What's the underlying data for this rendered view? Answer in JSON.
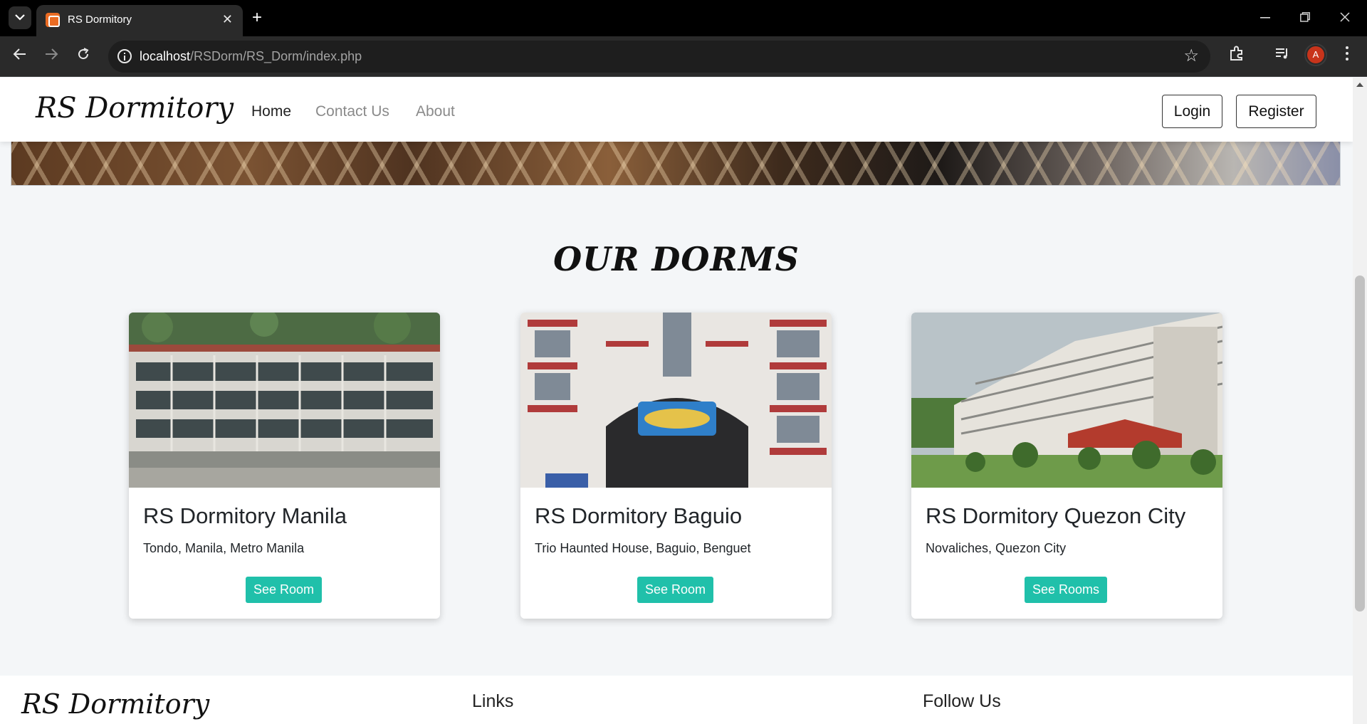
{
  "browser": {
    "tab_title": "RS Dormitory",
    "tab_close": "✕",
    "new_tab": "+",
    "url_host": "localhost",
    "url_path": "/RSDorm/RS_Dorm/index.php",
    "profile_initial": "A"
  },
  "navbar": {
    "brand": "RS Dormitory",
    "links": [
      {
        "label": "Home",
        "active": true
      },
      {
        "label": "Contact Us",
        "active": false
      },
      {
        "label": "About",
        "active": false
      }
    ],
    "login_label": "Login",
    "register_label": "Register"
  },
  "dorms": {
    "title": "OUR DORMS",
    "cards": [
      {
        "name": "RS Dormitory Manila",
        "location": "Tondo, Manila, Metro Manila",
        "button": "See Room"
      },
      {
        "name": "RS Dormitory Baguio",
        "location": "Trio Haunted House, Baguio, Benguet",
        "button": "See Room"
      },
      {
        "name": "RS Dormitory Quezon City",
        "location": "Novaliches, Quezon City",
        "button": "See Rooms"
      }
    ]
  },
  "footer": {
    "brand": "RS Dormitory",
    "links_heading": "Links",
    "follow_heading": "Follow Us"
  },
  "colors": {
    "accent": "#20c0aa",
    "page_bg": "#f4f6f8"
  }
}
